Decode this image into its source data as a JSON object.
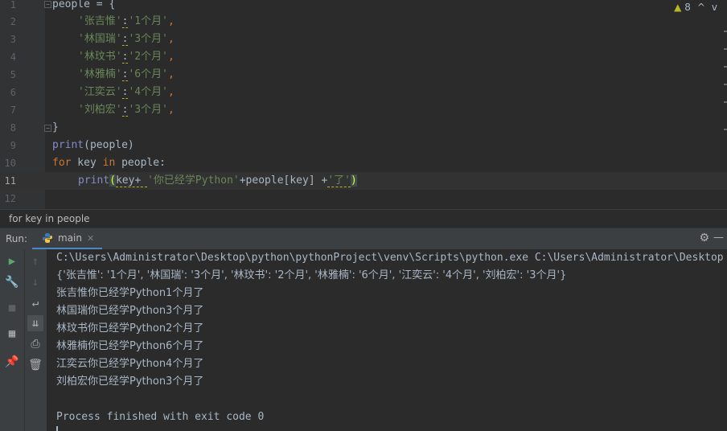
{
  "editor": {
    "line_numbers": [
      "1",
      "2",
      "3",
      "4",
      "5",
      "6",
      "7",
      "8",
      "9",
      "10",
      "11",
      "12"
    ],
    "lines": {
      "l1": {
        "a": "people = {"
      },
      "l2": {
        "str": "'张吉惟'",
        "colon": ":",
        "val": "'1个月'",
        "comma": ","
      },
      "l3": {
        "str": "'林国瑞'",
        "colon": ":",
        "val": "'3个月'",
        "comma": ","
      },
      "l4": {
        "str": "'林玟书'",
        "colon": ":",
        "val": "'2个月'",
        "comma": ","
      },
      "l5": {
        "str": "'林雅楠'",
        "colon": ":",
        "val": "'6个月'",
        "comma": ","
      },
      "l6": {
        "str": "'江奕云'",
        "colon": ":",
        "val": "'4个月'",
        "comma": ","
      },
      "l7": {
        "str": "'刘柏宏'",
        "colon": ":",
        "val": "'3个月'",
        "comma": ","
      },
      "l8": {
        "a": "}"
      },
      "l9": {
        "fn": "print",
        "rest": "(people)"
      },
      "l10": {
        "kw1": "for",
        "mid": " key ",
        "kw2": "in",
        "rest": " people:"
      },
      "l11": {
        "fn": "print",
        "p_open": "(",
        "a": "key+ ",
        "s1": "'你已经学Python'",
        "b": "+people[key] +",
        "s2": "'了'",
        "p_close": ")"
      }
    },
    "inspection": {
      "warning_count": "8",
      "up_arrow": "^",
      "down_arrow": "v"
    }
  },
  "breadcrumb": {
    "text": "for key in people"
  },
  "run_panel": {
    "label": "Run:",
    "tab_label": "main",
    "console": {
      "command": "C:\\Users\\Administrator\\Desktop\\python\\pythonProject\\venv\\Scripts\\python.exe C:\\Users\\Administrator\\Desktop",
      "dict_line": "{'张吉惟': '1个月', '林国瑞': '3个月', '林玟书': '2个月', '林雅楠': '6个月', '江奕云': '4个月', '刘柏宏': '3个月'}",
      "outputs": [
        "张吉惟你已经学Python1个月了",
        "林国瑞你已经学Python3个月了",
        "林玟书你已经学Python2个月了",
        "林雅楠你已经学Python6个月了",
        "江奕云你已经学Python4个月了",
        "刘柏宏你已经学Python3个月了"
      ],
      "exit": "Process finished with exit code 0"
    }
  },
  "colors": {
    "keyword": "#cc7832",
    "string": "#6a8759",
    "builtin": "#8888c6",
    "text": "#a9b7c6",
    "accent": "#4a88c7",
    "run_green": "#59a869"
  },
  "icons": [
    "run-icon",
    "wrench-icon",
    "stop-icon",
    "layout-icon",
    "pin-icon",
    "up-arrow-icon",
    "down-arrow-icon",
    "soft-wrap-icon",
    "scroll-to-end-icon",
    "print-icon",
    "trash-icon",
    "gear-icon",
    "minimize-icon",
    "python-icon",
    "close-icon",
    "warning-icon"
  ]
}
